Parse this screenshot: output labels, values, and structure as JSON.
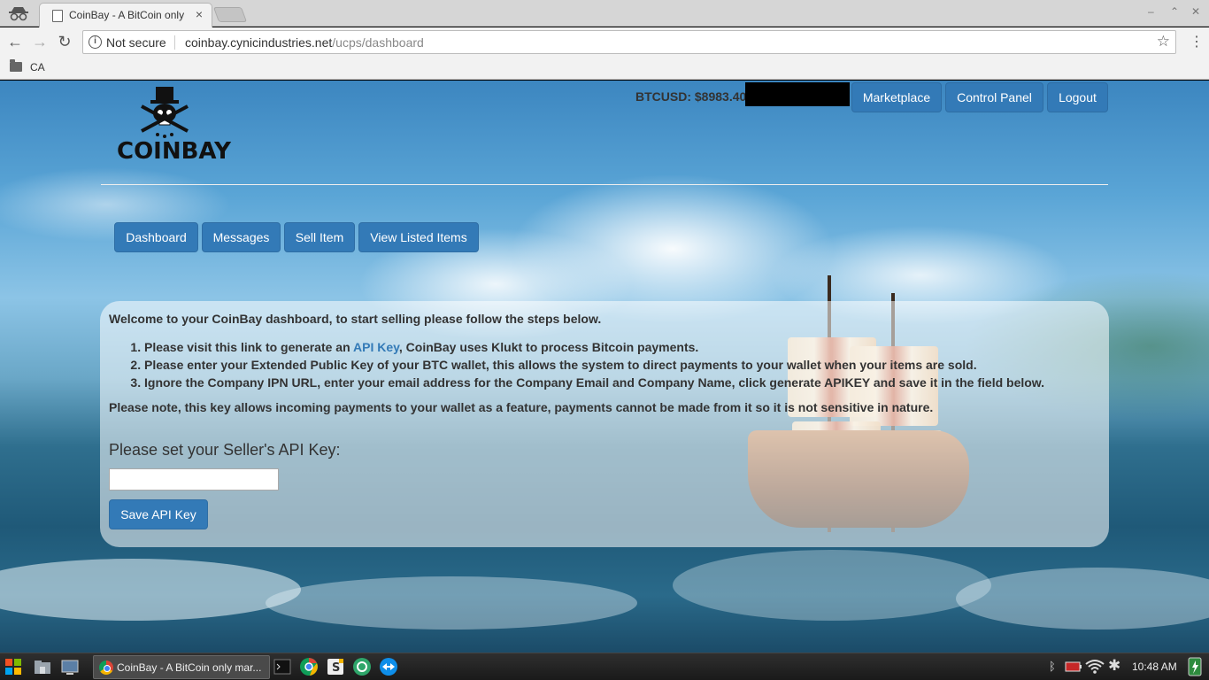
{
  "browser": {
    "tab_title": "CoinBay - A BitCoin only",
    "tab_close": "×",
    "window_controls": [
      "–",
      "⌃",
      "✕"
    ],
    "nav": {
      "back": "←",
      "forward": "→",
      "reload": "↻"
    },
    "security_label": "Not secure",
    "url_host": "coinbay.cynicindustries.net",
    "url_path": "/ucps/dashboard",
    "star": "☆",
    "menu": "⋮",
    "bookmark_folder": "CA"
  },
  "header": {
    "logo_text": "COINBAY",
    "btc_price": "BTCUSD: $8983.40",
    "nav_buttons": [
      "Marketplace",
      "Control Panel",
      "Logout"
    ]
  },
  "subnav": {
    "buttons": [
      "Dashboard",
      "Messages",
      "Sell Item",
      "View Listed Items"
    ]
  },
  "panel": {
    "intro": "Welcome to your CoinBay dashboard, to start selling please follow the steps below.",
    "steps": [
      {
        "prefix": "Please visit this link to generate an ",
        "link": "API Key",
        "suffix": ", CoinBay uses Klukt to process Bitcoin payments."
      },
      {
        "text": "Please enter your Extended Public Key of your BTC wallet, this allows the system to direct payments to your wallet when your items are sold."
      },
      {
        "text": "Ignore the Company IPN URL, enter your email address for the Company Email and Company Name, click generate APIKEY and save it in the field below."
      }
    ],
    "note": "Please note, this key allows incoming payments to your wallet as a feature, payments cannot be made from it so it is not sensitive in nature.",
    "api_label": "Please set your Seller's API Key:",
    "api_value": "",
    "save_button": "Save API Key"
  },
  "taskbar": {
    "task_title": "CoinBay - A BitCoin only mar...",
    "clock": "10:48 AM"
  },
  "colors": {
    "primary": "#337ab7",
    "primary_border": "#2e6da4"
  }
}
